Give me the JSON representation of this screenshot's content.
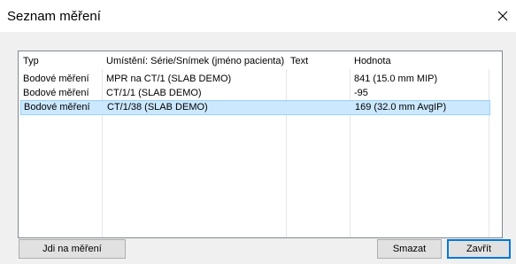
{
  "window": {
    "title": "Seznam měření",
    "close_glyph": "close-icon"
  },
  "table": {
    "columns": [
      "Typ",
      "Umístění: Série/Snímek (jméno pacienta)",
      "Text",
      "Hodnota"
    ],
    "rows": [
      {
        "type": "Bodové měření",
        "location": "MPR na CT/1  (SLAB DEMO)",
        "text": "",
        "value": "841  (15.0 mm MIP)",
        "selected": false
      },
      {
        "type": "Bodové měření",
        "location": "CT/1/1  (SLAB DEMO)",
        "text": "",
        "value": "-95",
        "selected": false
      },
      {
        "type": "Bodové měření",
        "location": "CT/1/38  (SLAB DEMO)",
        "text": "",
        "value": "169  (32.0 mm AvgIP)",
        "selected": true
      }
    ]
  },
  "buttons": {
    "goto_label": "Jdi na měření",
    "delete_label": "Smazat",
    "close_label": "Zavřít"
  },
  "colors": {
    "selection_fill": "#cce8ff",
    "selection_border": "#99d1ff",
    "default_button_border": "#0078d7",
    "content_background": "#f0f0f0"
  }
}
